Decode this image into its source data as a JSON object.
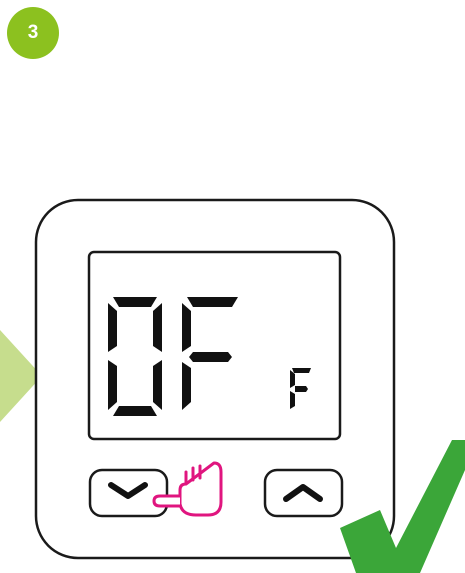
{
  "step": {
    "number": "3",
    "badge_color": "#8cc11f"
  },
  "device": {
    "display": {
      "main_text": "OF",
      "small_text": "F"
    },
    "buttons": [
      {
        "name": "down",
        "icon": "chevron-down-icon"
      },
      {
        "name": "up",
        "icon": "chevron-up-icon"
      }
    ]
  },
  "hint": {
    "icon": "pointing-hand-icon",
    "color": "#e0157f"
  },
  "arrow": {
    "icon": "arrow-right-icon",
    "color": "#c6dd8d"
  },
  "result": {
    "icon": "checkmark-icon",
    "color": "#3ba639"
  }
}
